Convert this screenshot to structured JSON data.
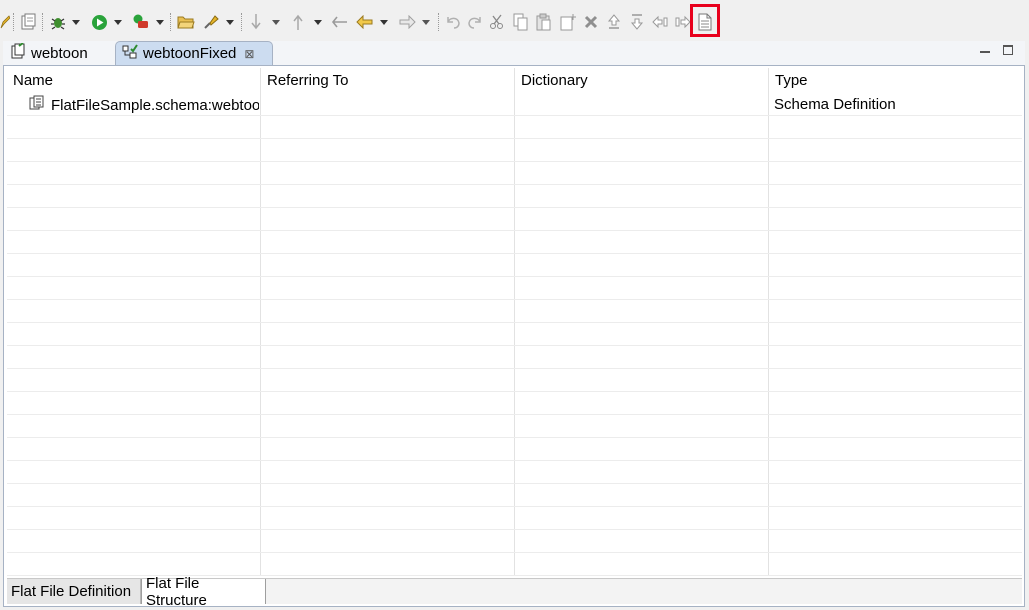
{
  "toolbar": {
    "icons": [
      "edit-pencil-icon",
      "save-icon",
      "debug-icon",
      "run-icon",
      "deploy-icon",
      "open-folder-icon",
      "pin-icon",
      "move-down-icon",
      "move-up-icon",
      "undo-arrow-icon",
      "back-arrow-icon",
      "forward-arrow-icon",
      "undo-icon",
      "redo-icon",
      "cut-icon",
      "copy-icon",
      "paste-icon",
      "new-document-icon",
      "delete-icon",
      "promote-icon",
      "demote-icon",
      "indent-left-icon",
      "indent-right-icon",
      "properties-document-icon"
    ]
  },
  "tabs": [
    {
      "label": "webtoon",
      "icon": "schema-icon",
      "active": false
    },
    {
      "label": "webtoonFixed",
      "icon": "flat-file-icon",
      "active": true,
      "close": "⊠"
    }
  ],
  "table": {
    "columns": [
      "Name",
      "Referring To",
      "Dictionary",
      "Type"
    ],
    "rows": [
      {
        "name": "FlatFileSample.schema:webtoonFixed",
        "referring_to": "",
        "dictionary": "",
        "type": "Schema Definition"
      }
    ]
  },
  "bottom_tabs": [
    "Flat File Definition",
    "Flat File Structure"
  ],
  "colors": {
    "accent_highlight": "#e8001c",
    "active_tab": "#ccdcf0",
    "frame_border": "#a6b2c4"
  }
}
